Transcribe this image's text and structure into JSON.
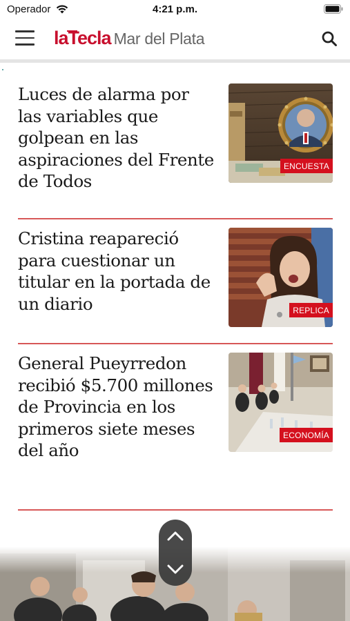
{
  "status_bar": {
    "carrier": "Operador",
    "time": "4:21 p.m."
  },
  "header": {
    "logo_la": "la",
    "logo_tecla": "Tecla",
    "logo_city": "Mar del Plata",
    "accent_color": "#c8102e"
  },
  "articles": [
    {
      "title": "Luces de alarma por las variables que golpean en las aspiraciones del Frente de Todos",
      "tag": "ENCUESTA"
    },
    {
      "title": "Cristina reapareció para cuestionar un titular en la portada de un diario",
      "tag": "REPLICA"
    },
    {
      "title": "General Pueyrredon recibió $5.700 millones de Provincia en los primeros siete meses del año",
      "tag": "ECONOMÍA"
    }
  ],
  "icons": {
    "menu": "menu-icon",
    "search": "search-icon",
    "wifi": "wifi-icon",
    "battery": "battery-icon",
    "scroll_up": "chevron-up-icon",
    "scroll_down": "chevron-down-icon"
  }
}
